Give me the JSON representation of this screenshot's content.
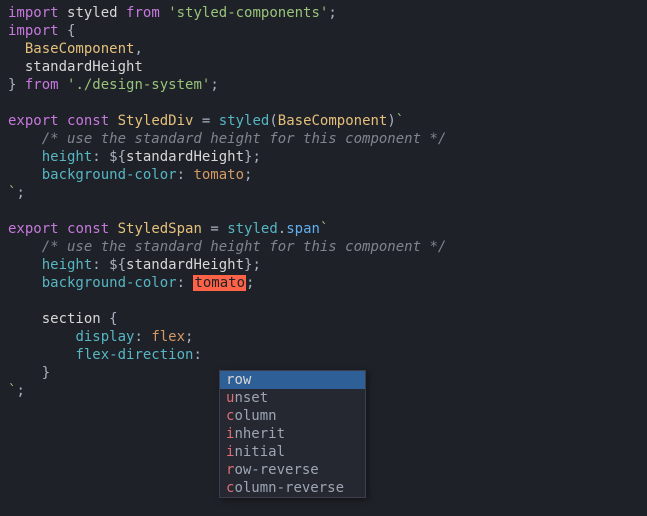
{
  "code": {
    "l1": {
      "kw1": "import",
      "id": "styled",
      "kw2": "from",
      "str": "'styled-components'",
      "end": ";"
    },
    "l2": {
      "kw": "import",
      "b": " {"
    },
    "l3": {
      "id": "BaseComponent",
      "c": ","
    },
    "l4": {
      "id": "standardHeight"
    },
    "l5": {
      "b": "} ",
      "kw": "from",
      "str": "'./design-system'",
      "end": ";"
    },
    "l7": {
      "kw1": "export",
      "kw2": "const",
      "id": "StyledDiv",
      "eq": " = ",
      "fn": "styled",
      "lp": "(",
      "arg": "BaseComponent",
      "rp": ")",
      "tick": "`"
    },
    "l8": {
      "comment": "/* use the standard height for this component */"
    },
    "l9": {
      "prop": "height",
      "col": ": ",
      "d1": "${",
      "var": "standardHeight",
      "d2": "}",
      "end": ";"
    },
    "l10": {
      "prop": "background-color",
      "col": ": ",
      "val": "tomato",
      "end": ";"
    },
    "l11": {
      "tick": "`",
      "end": ";"
    },
    "l13": {
      "kw1": "export",
      "kw2": "const",
      "id": "StyledSpan",
      "eq": " = ",
      "fn": "styled",
      "dot": ".",
      "prop": "span",
      "tick": "`"
    },
    "l14": {
      "comment": "/* use the standard height for this component */"
    },
    "l15": {
      "prop": "height",
      "col": ": ",
      "d1": "${",
      "var": "standardHeight",
      "d2": "}",
      "end": ";"
    },
    "l16": {
      "prop": "background-color",
      "col": ": ",
      "val": "tomato",
      "end": ";"
    },
    "l18": {
      "sel": "section",
      "b": " {"
    },
    "l19": {
      "prop": "display",
      "col": ": ",
      "val": "flex",
      "end": ";"
    },
    "l20": {
      "prop": "flex-direction",
      "col": ":"
    },
    "l21": {
      "b": "}"
    },
    "l22": {
      "tick": "`",
      "end": ";"
    }
  },
  "popup": {
    "items": [
      {
        "match": "r",
        "rest": "ow",
        "selected": true
      },
      {
        "match": "u",
        "rest": "nset",
        "selected": false
      },
      {
        "match": "c",
        "rest": "olumn",
        "selected": false
      },
      {
        "match": "i",
        "rest": "nherit",
        "selected": false
      },
      {
        "match": "i",
        "rest": "nitial",
        "selected": false
      },
      {
        "match": "r",
        "rest": "ow-reverse",
        "selected": false
      },
      {
        "match": "c",
        "rest": "olumn-reverse",
        "selected": false
      }
    ]
  }
}
